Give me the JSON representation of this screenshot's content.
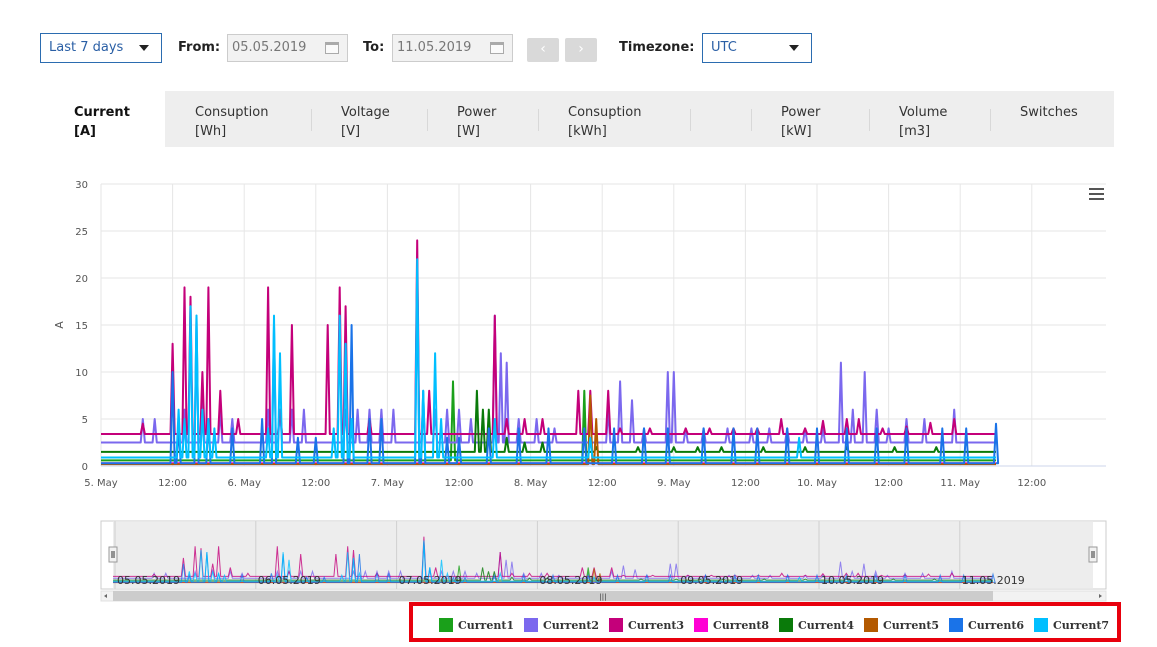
{
  "toolbar": {
    "range_select": "Last 7 days",
    "from_label": "From:",
    "from_value": "05.05.2019",
    "to_label": "To:",
    "to_value": "11.05.2019",
    "prev_label": "‹",
    "next_label": "›",
    "timezone_label": "Timezone:",
    "timezone_value": "UTC"
  },
  "tabs": [
    {
      "line1": "Current",
      "line2": "[A]",
      "active": true
    },
    {
      "line1": "Consuption",
      "line2": "[Wh]"
    },
    {
      "line1": "Voltage",
      "line2": "[V]"
    },
    {
      "line1": "Power",
      "line2": "[W]"
    },
    {
      "line1": "Consuption",
      "line2": "[kWh]"
    },
    {
      "line1": "",
      "line2": ""
    },
    {
      "line1": "Power",
      "line2": "[kW]"
    },
    {
      "line1": "Volume",
      "line2": "[m3]"
    },
    {
      "line1": "Switches",
      "line2": ""
    }
  ],
  "chart_data": {
    "type": "line",
    "ylabel": "A",
    "ylim": [
      0,
      30
    ],
    "yticks": [
      0,
      5,
      10,
      15,
      20,
      25,
      30
    ],
    "xlim_hours": [
      0,
      156
    ],
    "x_tick_labels": [
      "5. May",
      "12:00",
      "6. May",
      "12:00",
      "7. May",
      "12:00",
      "8. May",
      "12:00",
      "9. May",
      "12:00",
      "10. May",
      "12:00",
      "11. May",
      "12:00"
    ],
    "navigator_labels": [
      "05.05.2019",
      "06.05.2019",
      "07.05.2019",
      "08.05.2019",
      "09.05.2019",
      "10.05.2019",
      "11.05.2019"
    ],
    "grid": true,
    "legend_position": "bottom-right",
    "series": [
      {
        "name": "Current1",
        "color": "#1aa01a",
        "base": 0.6,
        "peaks": [
          [
            59,
            9
          ],
          [
            81,
            8
          ],
          [
            81,
            6
          ]
        ]
      },
      {
        "name": "Current2",
        "color": "#7b68ee",
        "base": 2.5,
        "peaks": [
          [
            7,
            5
          ],
          [
            9,
            5
          ],
          [
            14,
            6
          ],
          [
            17,
            7
          ],
          [
            20,
            6
          ],
          [
            22,
            5
          ],
          [
            28,
            6
          ],
          [
            30,
            6
          ],
          [
            32,
            6
          ],
          [
            34,
            6
          ],
          [
            41,
            6
          ],
          [
            43,
            6
          ],
          [
            45,
            6
          ],
          [
            47,
            6
          ],
          [
            49,
            6
          ],
          [
            54,
            6
          ],
          [
            56,
            6
          ],
          [
            58,
            6
          ],
          [
            60,
            6
          ],
          [
            62,
            5
          ],
          [
            66,
            16
          ],
          [
            67,
            12
          ],
          [
            68,
            11
          ],
          [
            70,
            5
          ],
          [
            73,
            5
          ],
          [
            76,
            4
          ],
          [
            85,
            6
          ],
          [
            87,
            9
          ],
          [
            89,
            7
          ],
          [
            91,
            4
          ],
          [
            95,
            10
          ],
          [
            96,
            10
          ],
          [
            98,
            4
          ],
          [
            101,
            4
          ],
          [
            105,
            4
          ],
          [
            109,
            4
          ],
          [
            112,
            4
          ],
          [
            115,
            4
          ],
          [
            118,
            4
          ],
          [
            121,
            4
          ],
          [
            124,
            11
          ],
          [
            126,
            6
          ],
          [
            128,
            10
          ],
          [
            130,
            6
          ],
          [
            132,
            4
          ],
          [
            135,
            5
          ],
          [
            138,
            5
          ],
          [
            143,
            6
          ]
        ]
      },
      {
        "name": "Current3",
        "color": "#c4007a",
        "base": 3.4,
        "peaks": [
          [
            7,
            4.5
          ],
          [
            12,
            13
          ],
          [
            14,
            19
          ],
          [
            15,
            18
          ],
          [
            17,
            10
          ],
          [
            18,
            19
          ],
          [
            20,
            8
          ],
          [
            23,
            5
          ],
          [
            28,
            19
          ],
          [
            30,
            6
          ],
          [
            32,
            15
          ],
          [
            38,
            15
          ],
          [
            40,
            19
          ],
          [
            41,
            17
          ],
          [
            45,
            5
          ],
          [
            53,
            24
          ],
          [
            55,
            8
          ],
          [
            66,
            16
          ],
          [
            68,
            5
          ],
          [
            71,
            5
          ],
          [
            74,
            5
          ],
          [
            80,
            8
          ],
          [
            82,
            8
          ],
          [
            85,
            8
          ],
          [
            87,
            4
          ],
          [
            92,
            4
          ],
          [
            98,
            4
          ],
          [
            102,
            4
          ],
          [
            106,
            4
          ],
          [
            110,
            4
          ],
          [
            114,
            5
          ],
          [
            118,
            4
          ],
          [
            121,
            4.8
          ],
          [
            125,
            5
          ],
          [
            127,
            5
          ],
          [
            131,
            4
          ],
          [
            135,
            4.2
          ],
          [
            139,
            4.6
          ],
          [
            143,
            5
          ]
        ]
      },
      {
        "name": "Current8",
        "color": "#ff00d4",
        "base": 0.3,
        "peaks": []
      },
      {
        "name": "Current4",
        "color": "#0a7a0a",
        "base": 1.5,
        "peaks": [
          [
            63,
            8
          ],
          [
            64,
            6
          ],
          [
            65,
            6
          ],
          [
            68,
            3
          ],
          [
            71,
            2.5
          ],
          [
            74,
            2.5
          ],
          [
            83,
            2
          ],
          [
            90,
            2
          ],
          [
            96,
            2
          ],
          [
            100,
            2
          ],
          [
            104,
            2
          ],
          [
            111,
            2
          ],
          [
            118,
            2
          ],
          [
            125,
            2
          ],
          [
            133,
            2
          ],
          [
            140,
            2
          ]
        ]
      },
      {
        "name": "Current5",
        "color": "#b35900",
        "base": 0.2,
        "peaks": [
          [
            82,
            7.5
          ],
          [
            83,
            5
          ]
        ]
      },
      {
        "name": "Current6",
        "color": "#1a73e8",
        "base": 0.3,
        "peaks": [
          [
            12,
            10
          ],
          [
            13,
            4
          ],
          [
            16,
            16
          ],
          [
            18,
            5
          ],
          [
            22,
            4
          ],
          [
            27,
            5
          ],
          [
            29,
            15
          ],
          [
            33,
            3
          ],
          [
            36,
            3
          ],
          [
            41,
            13
          ],
          [
            42,
            15
          ],
          [
            45,
            5
          ],
          [
            47,
            5
          ],
          [
            53,
            21
          ],
          [
            54,
            8
          ],
          [
            58,
            3
          ],
          [
            60,
            3
          ],
          [
            65,
            4
          ],
          [
            70,
            4
          ],
          [
            75,
            4
          ],
          [
            81,
            4
          ],
          [
            86,
            4
          ],
          [
            91,
            4
          ],
          [
            95,
            4
          ],
          [
            101,
            4
          ],
          [
            106,
            4
          ],
          [
            110,
            4
          ],
          [
            115,
            4
          ],
          [
            120,
            4
          ],
          [
            125,
            4
          ],
          [
            130,
            4
          ],
          [
            135,
            4
          ],
          [
            141,
            4
          ],
          [
            145,
            4
          ],
          [
            150,
            4.5
          ]
        ]
      },
      {
        "name": "Current7",
        "color": "#00bfff",
        "base": 0.9,
        "peaks": [
          [
            13,
            6
          ],
          [
            14,
            5
          ],
          [
            15,
            17
          ],
          [
            16,
            16
          ],
          [
            17,
            6
          ],
          [
            18,
            5
          ],
          [
            19,
            4
          ],
          [
            28,
            4
          ],
          [
            29,
            16
          ],
          [
            30,
            12
          ],
          [
            39,
            4
          ],
          [
            40,
            16
          ],
          [
            41,
            13
          ],
          [
            42,
            5
          ],
          [
            53,
            22
          ],
          [
            54,
            8
          ],
          [
            56,
            12
          ],
          [
            57,
            5
          ],
          [
            66,
            5
          ],
          [
            82,
            3
          ],
          [
            117,
            3
          ]
        ]
      }
    ]
  }
}
